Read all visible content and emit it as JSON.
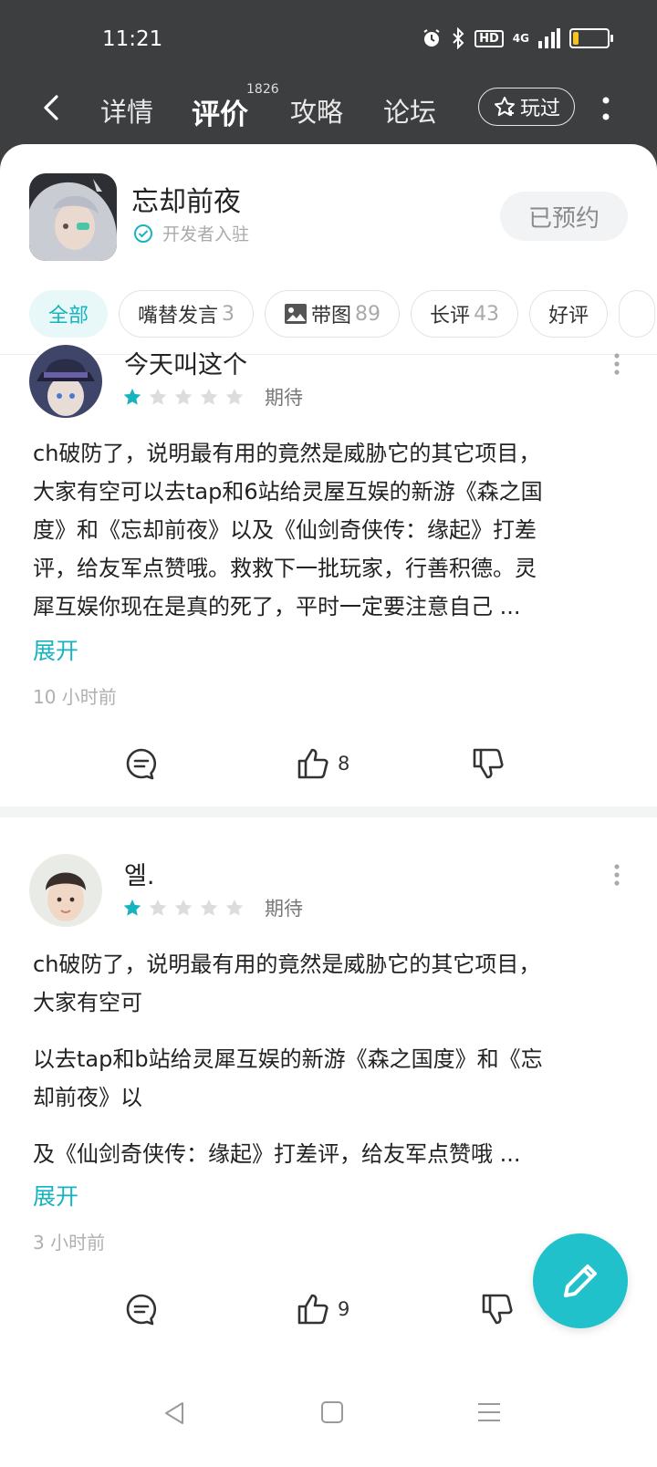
{
  "status": {
    "time": "11:21",
    "network": "4G",
    "hd": "HD"
  },
  "nav": {
    "tabs": [
      {
        "label": "详情"
      },
      {
        "label": "评价",
        "count": "1826"
      },
      {
        "label": "攻略"
      },
      {
        "label": "论坛"
      }
    ],
    "played_label": "玩过"
  },
  "game": {
    "title": "忘却前夜",
    "developer_badge": "开发者入驻",
    "reserve_label": "已预约"
  },
  "filters": [
    {
      "label": "全部"
    },
    {
      "label": "嘴替发言",
      "count": "3"
    },
    {
      "label": "带图",
      "count": "89"
    },
    {
      "label": "长评",
      "count": "43"
    },
    {
      "label": "好评"
    }
  ],
  "reviews": [
    {
      "user": "今天叫这个",
      "rating": 1,
      "rating_max": 5,
      "tag": "期待",
      "lines": [
        "ch破防了，说明最有用的竟然是威胁它的其它项目，",
        "大家有空可以去tap和6站给灵屋互娱的新游《森之国",
        "度》和《忘却前夜》以及《仙剑奇侠传：缘起》打差",
        "评，给友军点赞哦。救救下一批玩家，行善积德。灵",
        "犀互娱你现在是真的死了，平时一定要注意自己 ..."
      ],
      "expand": "展开",
      "time": "10 小时前",
      "likes": "8"
    },
    {
      "user": "엘.",
      "rating": 1,
      "rating_max": 5,
      "tag": "期待",
      "paragraphs": [
        [
          "ch破防了，说明最有用的竟然是威胁它的其它项目，",
          "大家有空可"
        ],
        [
          "以去tap和b站给灵犀互娱的新游《森之国度》和《忘",
          "却前夜》以"
        ],
        [
          "及《仙剑奇侠传：缘起》打差评，给友军点赞哦 ..."
        ]
      ],
      "expand": "展开",
      "time": "3 小时前",
      "likes": "9"
    }
  ],
  "colors": {
    "accent": "#17b3bf",
    "header_bg": "#3d3e40",
    "star_on": "#17b3bf",
    "star_off": "#dcdcdc"
  }
}
